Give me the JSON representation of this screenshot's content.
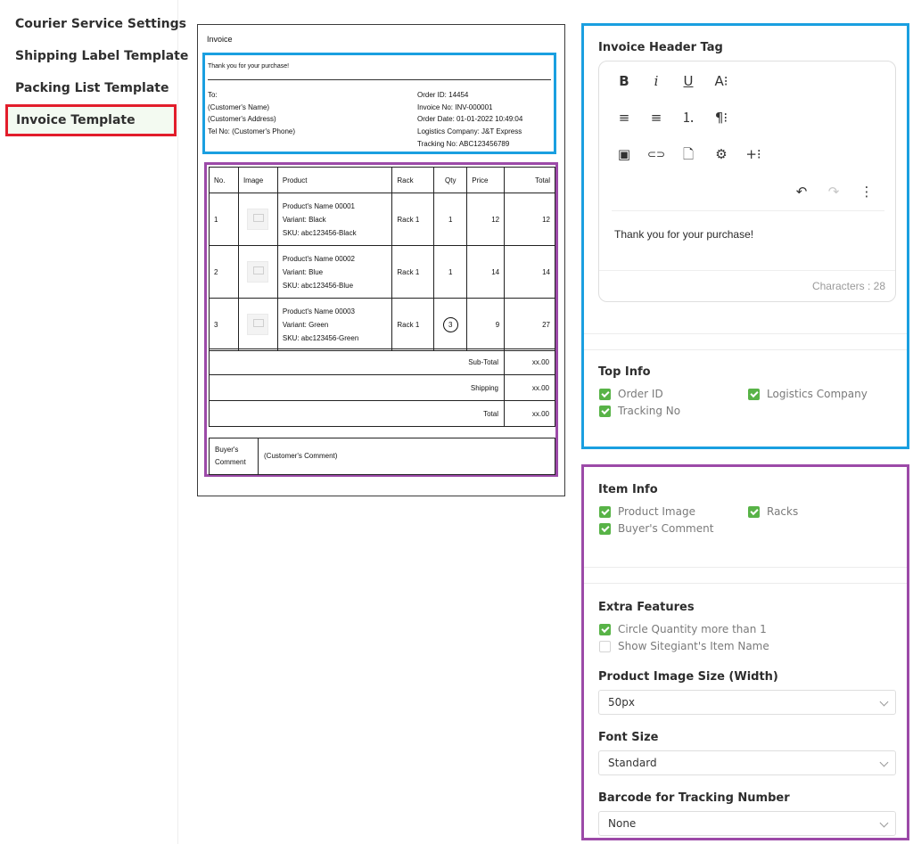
{
  "sidebar": {
    "items": [
      {
        "label": "Courier Service Settings"
      },
      {
        "label": "Shipping Label Template"
      },
      {
        "label": "Packing List Template"
      },
      {
        "label": "Invoice Template"
      }
    ]
  },
  "preview": {
    "title": "Invoice",
    "thanks": "Thank you for your purchase!",
    "to": {
      "label": "To:",
      "name": "(Customer's Name)",
      "address": "(Customer's Address)",
      "phone": "Tel No: (Customer's Phone)"
    },
    "order": {
      "order_id": "Order ID: 14454",
      "invoice_no": "Invoice No: INV-000001",
      "order_date": "Order Date: 01-01-2022 10:49:04",
      "logistics": "Logistics Company: J&T Express",
      "tracking": "Tracking No: ABC123456789"
    },
    "columns": [
      "No.",
      "Image",
      "Product",
      "Rack",
      "Qty",
      "Price",
      "Total"
    ],
    "rows": [
      {
        "no": "1",
        "name": "Product's Name 00001",
        "variant": "Variant: Black",
        "sku": "SKU: abc123456-Black",
        "rack": "Rack 1",
        "qty": "1",
        "price": "12",
        "total": "12"
      },
      {
        "no": "2",
        "name": "Product's Name 00002",
        "variant": "Variant: Blue",
        "sku": "SKU: abc123456-Blue",
        "rack": "Rack 1",
        "qty": "1",
        "price": "14",
        "total": "14"
      },
      {
        "no": "3",
        "name": "Product's Name 00003",
        "variant": "Variant: Green",
        "sku": "SKU: abc123456-Green",
        "rack": "Rack 1",
        "qty": "3",
        "price": "9",
        "total": "27"
      }
    ],
    "summary": [
      {
        "label": "Sub-Total",
        "value": "xx.00"
      },
      {
        "label": "Shipping",
        "value": "xx.00"
      },
      {
        "label": "Total",
        "value": "xx.00"
      }
    ],
    "comment": {
      "label_line1": "Buyer's",
      "label_line2": "Comment",
      "value": "(Customer's Comment)"
    }
  },
  "header_panel": {
    "title": "Invoice Header Tag",
    "toolbar": {
      "bold": "B",
      "italic": "i",
      "underline": "U",
      "font_size": "A⁝",
      "align": "≡",
      "align_center": "≡",
      "numbered_list": "⒈",
      "bullet_list": "☰",
      "paragraph": "¶⁝",
      "image": "▣",
      "link": "⊂⊃",
      "file": "🗋",
      "settings": "⚙",
      "insert": "+⁝",
      "undo": "↶",
      "redo": "↷",
      "more": "⋮"
    },
    "content": "Thank you for your purchase!",
    "char_count": "Characters : 28"
  },
  "top_info": {
    "title": "Top Info",
    "options": [
      {
        "label": "Order ID",
        "checked": true
      },
      {
        "label": "Logistics Company",
        "checked": true
      },
      {
        "label": "Tracking No",
        "checked": true
      }
    ]
  },
  "item_info": {
    "title": "Item Info",
    "options": [
      {
        "label": "Product Image",
        "checked": true
      },
      {
        "label": "Racks",
        "checked": true
      },
      {
        "label": "Buyer's Comment",
        "checked": true
      }
    ]
  },
  "extra_features": {
    "title": "Extra Features",
    "options": [
      {
        "label": "Circle Quantity more than 1",
        "checked": true
      },
      {
        "label": "Show Sitegiant's Item Name",
        "checked": false
      }
    ]
  },
  "image_size": {
    "title": "Product Image Size (Width)",
    "value": "50px"
  },
  "font_size": {
    "title": "Font Size",
    "value": "Standard"
  },
  "barcode": {
    "title": "Barcode for Tracking Number",
    "value": "None"
  },
  "colors": {
    "accent_blue": "#1a9fe0",
    "accent_purple": "#9c4aa8",
    "active_red": "#e21d2b",
    "check_green": "#58b347"
  }
}
